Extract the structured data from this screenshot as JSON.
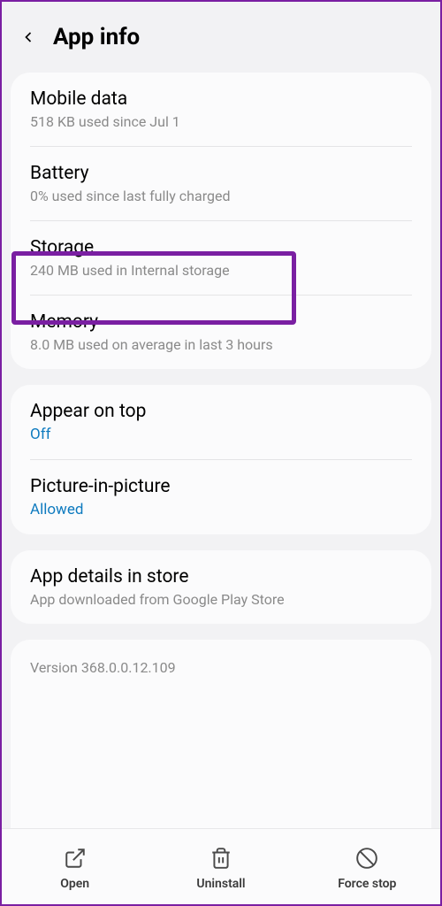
{
  "header": {
    "title": "App info"
  },
  "sections": {
    "mobileData": {
      "title": "Mobile data",
      "subtitle": "518 KB used since Jul 1"
    },
    "battery": {
      "title": "Battery",
      "subtitle": "0% used since last fully charged"
    },
    "storage": {
      "title": "Storage",
      "subtitle": "240 MB used in Internal storage"
    },
    "memory": {
      "title": "Memory",
      "subtitle": "8.0 MB used on average in last 3 hours"
    },
    "appearOnTop": {
      "title": "Appear on top",
      "subtitle": "Off"
    },
    "pip": {
      "title": "Picture-in-picture",
      "subtitle": "Allowed"
    },
    "appDetails": {
      "title": "App details in store",
      "subtitle": "App downloaded from Google Play Store"
    },
    "version": "Version 368.0.0.12.109"
  },
  "bottomBar": {
    "open": "Open",
    "uninstall": "Uninstall",
    "forceStop": "Force stop"
  },
  "highlight": {
    "color": "#7a1fa2"
  }
}
